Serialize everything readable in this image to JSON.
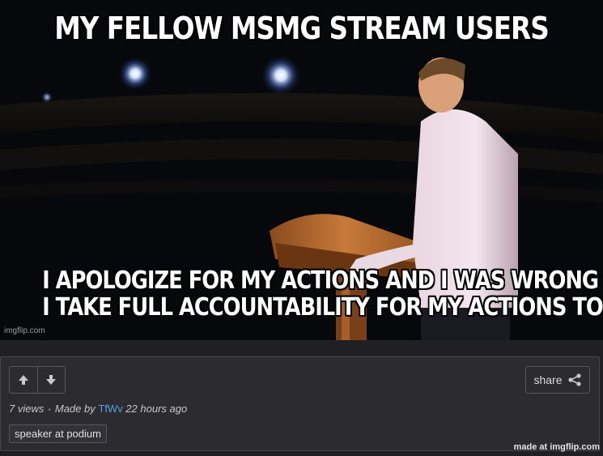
{
  "meme": {
    "top_text": "MY FELLOW MSMG STREAM USERS",
    "bottom_text_line1": "I APOLOGIZE FOR MY ACTIONS AND I WAS WRONG",
    "bottom_text_line2": "I TAKE FULL ACCOUNTABILITY FOR MY ACTIONS TO AND FOR",
    "watermark": "imgflip.com"
  },
  "panel": {
    "upvote_icon": "arrow-up-icon",
    "downvote_icon": "arrow-down-icon",
    "share_label": "share",
    "share_icon": "share-icon",
    "views": "7 views",
    "separator": "•",
    "made_by_prefix": "Made by",
    "username": "TfWv",
    "time_ago": "22 hours ago",
    "tag": "speaker at podium"
  },
  "footer": {
    "made_at": "made at imgflip.com"
  },
  "colors": {
    "background": "#1f1f24",
    "panel": "#2b2b30",
    "username_link": "#5b9cf0"
  }
}
